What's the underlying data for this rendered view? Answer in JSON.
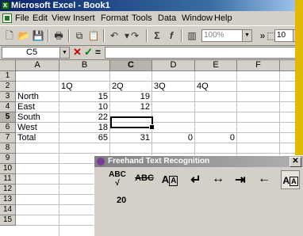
{
  "window": {
    "title": "Microsoft Excel - Book1"
  },
  "menu": [
    "File",
    "Edit",
    "View",
    "Insert",
    "Format",
    "Tools",
    "Data",
    "Window",
    "Help"
  ],
  "toolbar": {
    "icons": [
      "new-icon",
      "open-icon",
      "save-icon",
      "print-icon",
      "copy-icon",
      "paste-icon",
      "undo-icon",
      "redo-icon",
      "autosum-icon",
      "function-icon",
      "chart-icon"
    ],
    "zoom": "100%",
    "font_size": "10",
    "more": "»"
  },
  "formula_bar": {
    "name_box": "C5",
    "cancel": "✕",
    "enter": "✓",
    "equals": "=",
    "content": ""
  },
  "columns": [
    "A",
    "B",
    "C",
    "D",
    "E",
    "F",
    "G"
  ],
  "rows": [
    "1",
    "2",
    "3",
    "4",
    "5",
    "6",
    "7",
    "8",
    "9",
    "10",
    "11",
    "12",
    "13",
    "14",
    "15"
  ],
  "cells": {
    "B2": "1Q",
    "C2": "2Q",
    "D2": "3Q",
    "E2": "4Q",
    "A3": "North",
    "B3": "15",
    "C3": "19",
    "A4": "East",
    "B4": "10",
    "C4": "12",
    "A5": "South",
    "B5": "22",
    "A6": "West",
    "B6": "18",
    "A7": "Total",
    "B7": "65",
    "C7": "31",
    "D7": "0",
    "E7": "0"
  },
  "active_cell": "C5",
  "recognition_panel": {
    "title": "Freehand Text Recognition",
    "close": "✕",
    "tools": [
      "ABC",
      "ABC",
      "A",
      "↵",
      "↔",
      "⇥",
      "←",
      "A"
    ],
    "ink_text": "20"
  },
  "colors": {
    "titlebar": "#0a246a",
    "desktop": "#e0b800",
    "excel_green": "#1e7a1e"
  }
}
